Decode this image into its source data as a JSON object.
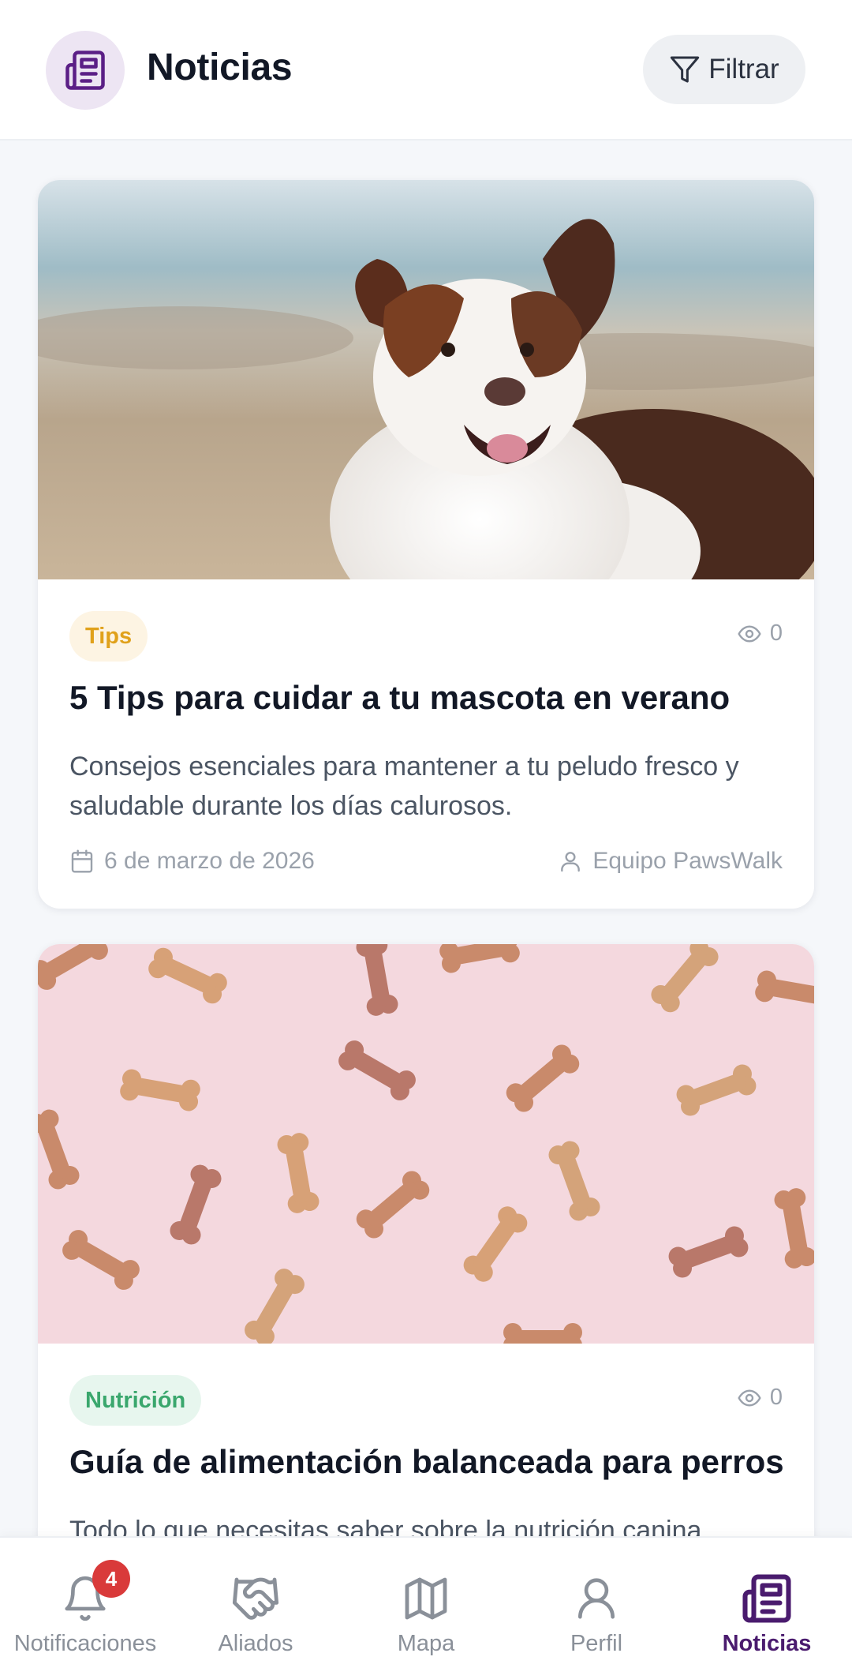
{
  "header": {
    "title": "Noticias",
    "filter_label": "Filtrar",
    "logo_icon": "newspaper-icon",
    "filter_icon": "filter-icon"
  },
  "articles": [
    {
      "tag": "Tips",
      "tag_color": "#e0a11b",
      "tag_bg": "#fdf4e3",
      "views": "0",
      "title": "5 Tips para cuidar a tu mascota en verano",
      "excerpt": "Consejos esenciales para mantener a tu peludo fresco y saludable durante los días calurosos.",
      "date": "6 de marzo de 2026",
      "author": "Equipo PawsWalk",
      "image": "dog-photo"
    },
    {
      "tag": "Nutrición",
      "tag_color": "#3aa76d",
      "tag_bg": "#e7f6ee",
      "views": "0",
      "title": "Guía de alimentación balanceada para perros",
      "excerpt": "Todo lo que necesitas saber sobre la nutrición canina",
      "image": "dog-treats-photo"
    }
  ],
  "bottom_nav": {
    "items": [
      {
        "label": "Notificaciones",
        "icon": "bell-icon",
        "badge": "4"
      },
      {
        "label": "Aliados",
        "icon": "handshake-icon"
      },
      {
        "label": "Mapa",
        "icon": "map-icon"
      },
      {
        "label": "Perfil",
        "icon": "user-icon"
      },
      {
        "label": "Noticias",
        "icon": "newspaper-icon",
        "active": true
      }
    ]
  },
  "colors": {
    "brand": "#4a1b6e",
    "inactive": "#8a9099",
    "badge": "#d93a3a"
  }
}
